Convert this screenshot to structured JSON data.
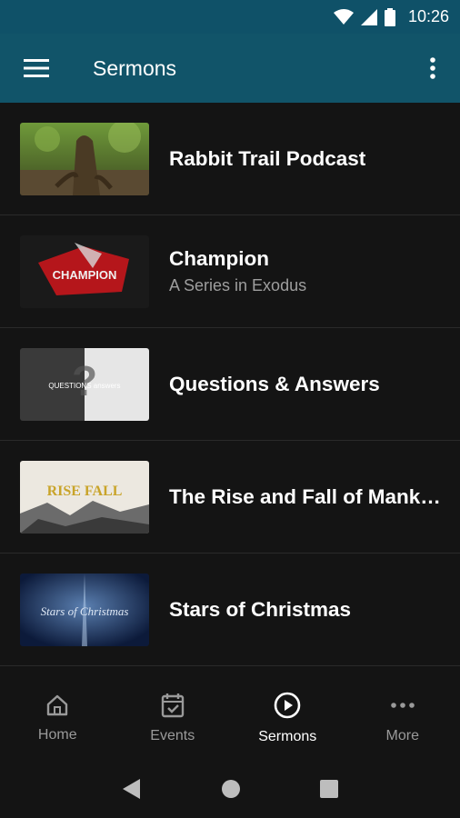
{
  "status_bar": {
    "time": "10:26",
    "icons": [
      "wifi-icon",
      "signal-icon",
      "battery-icon"
    ]
  },
  "app_bar": {
    "title": "Sermons",
    "menu_icon": "hamburger-menu-icon",
    "overflow_icon": "more-vertical-icon"
  },
  "sermons": [
    {
      "title": "Rabbit Trail Podcast",
      "subtitle": ""
    },
    {
      "title": "Champion",
      "subtitle": "A Series in Exodus",
      "thumb_text": "CHAMPION"
    },
    {
      "title": "Questions & Answers",
      "subtitle": "",
      "thumb_text": "QUESTIONS answers"
    },
    {
      "title": "The Rise and Fall of Mank…",
      "subtitle": "",
      "thumb_text": "RISE FALL"
    },
    {
      "title": "Stars of Christmas",
      "subtitle": "",
      "thumb_text": "Stars of Christmas"
    }
  ],
  "bottom_nav": [
    {
      "label": "Home",
      "icon": "home-icon",
      "active": false
    },
    {
      "label": "Events",
      "icon": "calendar-check-icon",
      "active": false
    },
    {
      "label": "Sermons",
      "icon": "play-circle-icon",
      "active": true
    },
    {
      "label": "More",
      "icon": "more-horizontal-icon",
      "active": false
    }
  ],
  "colors": {
    "app_bar": "#115469",
    "background": "#141414",
    "subtitle": "#9e9e9e"
  }
}
